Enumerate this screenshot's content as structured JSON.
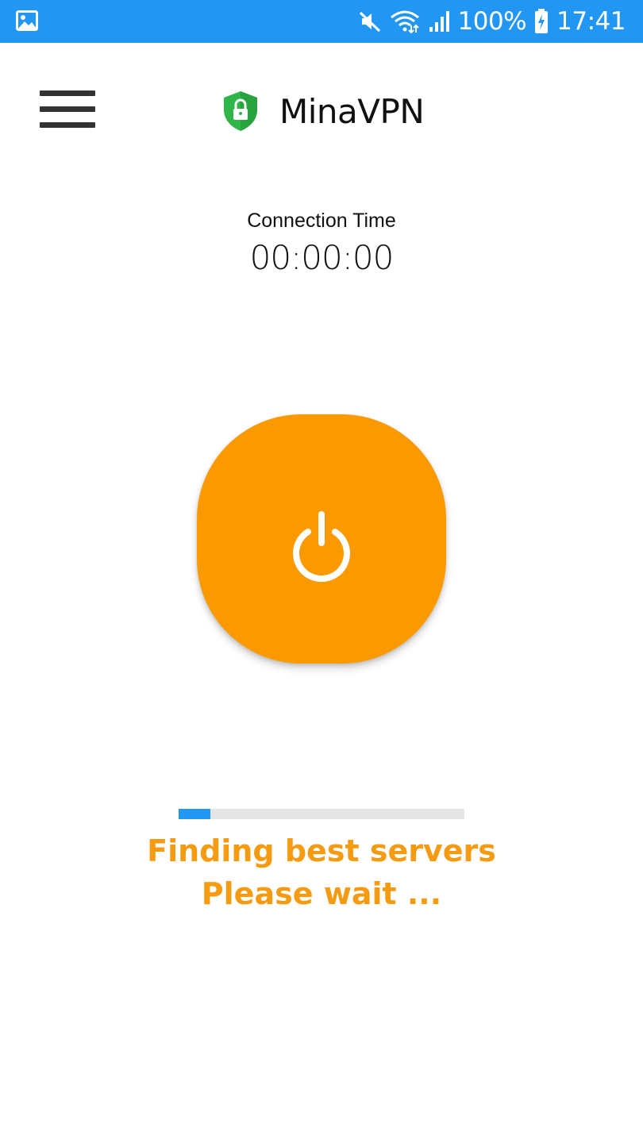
{
  "status_bar": {
    "icons": [
      "gallery-icon",
      "mute-icon",
      "wifi-icon",
      "signal-icon",
      "battery-charging-icon"
    ],
    "battery": "100%",
    "time": "17:41",
    "background": "#2196f3"
  },
  "header": {
    "menu_icon": "hamburger-menu-icon",
    "logo_icon": "shield-lock-icon",
    "title": "MinaVPN"
  },
  "connection": {
    "label": "Connection Time",
    "time": "00:00:00"
  },
  "power_button": {
    "icon": "power-icon",
    "color": "#fb9a00"
  },
  "progress": {
    "fraction": 0.11,
    "track_color": "#e5e5e5",
    "fill_color": "#2196f3"
  },
  "status": {
    "line1": "Finding best servers",
    "line2": "Please wait ...",
    "color": "#f59b12"
  }
}
